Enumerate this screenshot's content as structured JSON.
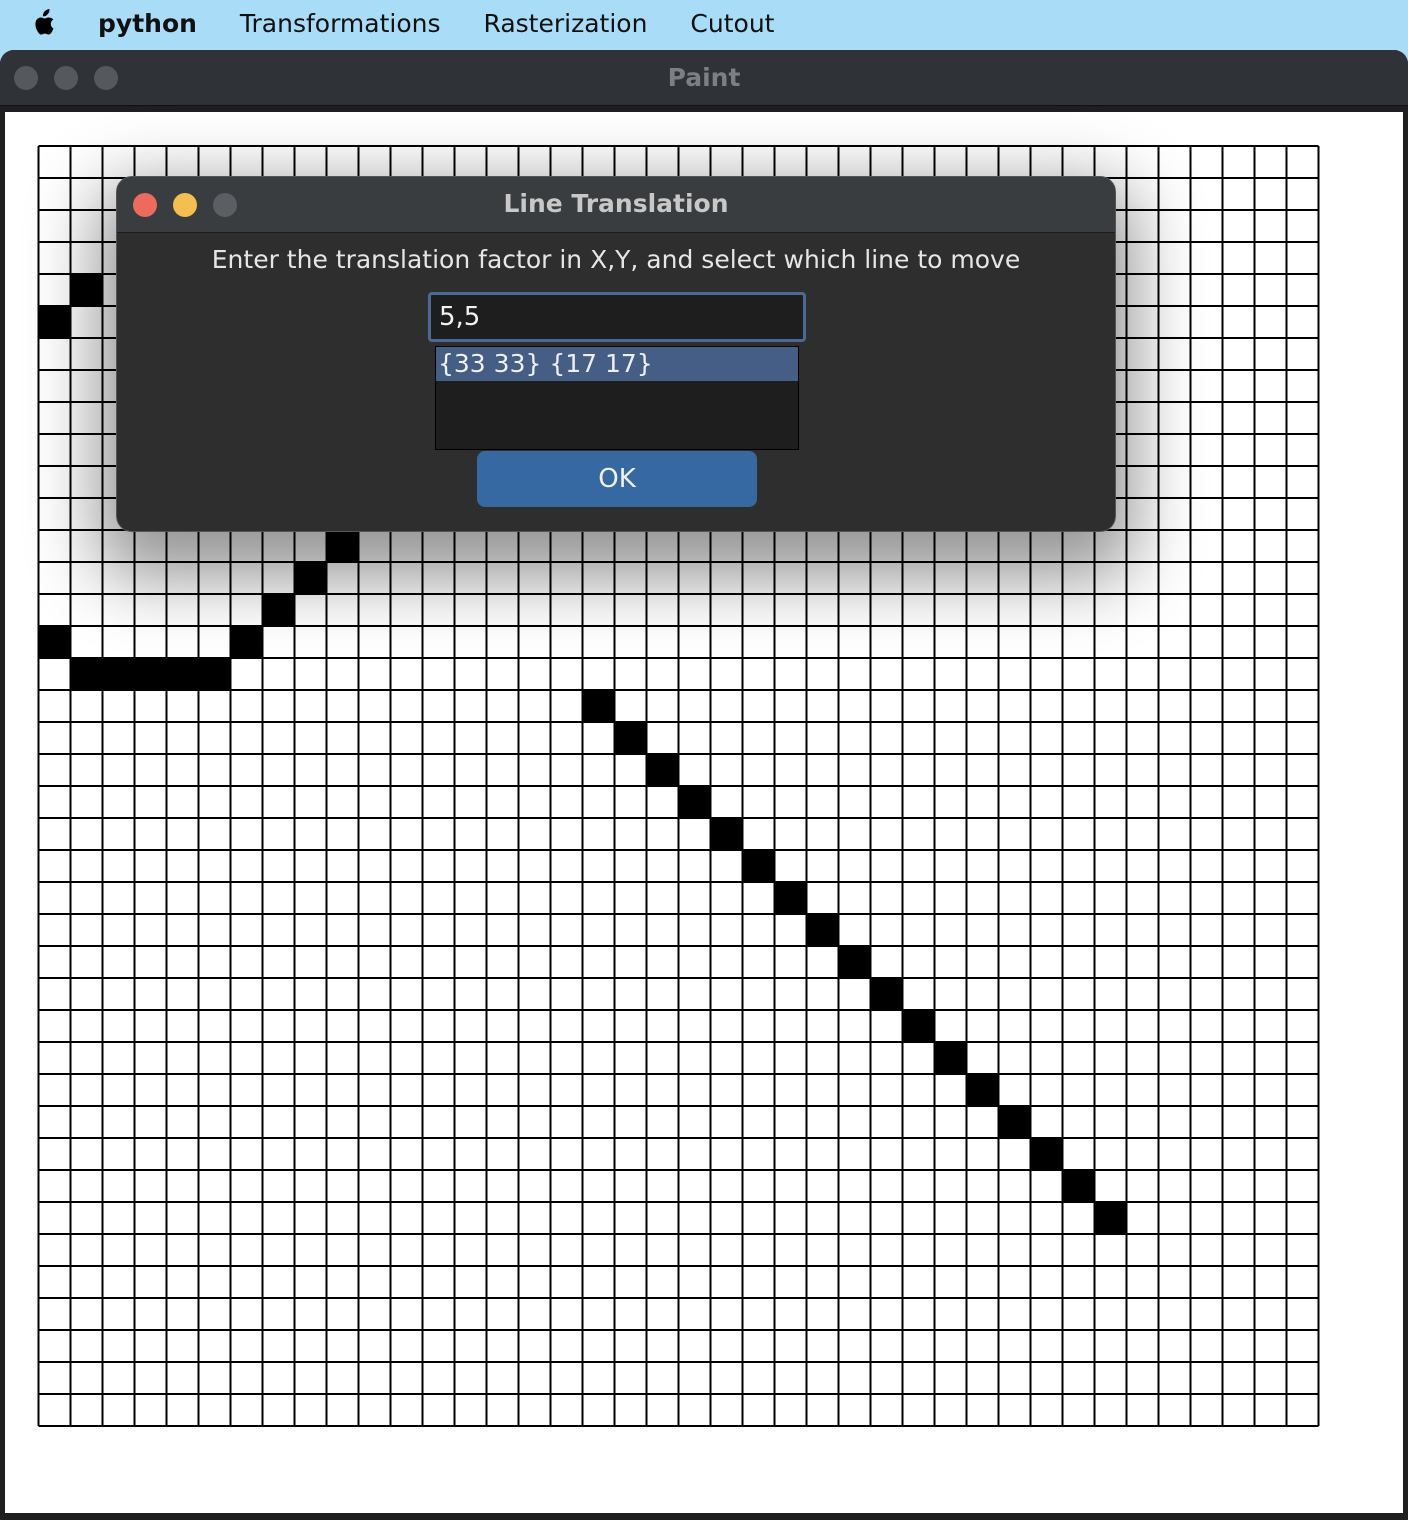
{
  "menubar": {
    "apple_icon": "apple-logo-icon",
    "items": [
      "python",
      "Transformations",
      "Rasterization",
      "Cutout"
    ]
  },
  "window": {
    "title": "Paint",
    "controls_color": "#55585c"
  },
  "canvas": {
    "grid_cells": [
      40,
      40
    ],
    "filled_cells": [
      [
        1,
        4
      ],
      [
        0,
        5
      ],
      [
        9,
        12
      ],
      [
        8,
        13
      ],
      [
        7,
        14
      ],
      [
        6,
        15
      ],
      [
        0,
        15
      ],
      [
        1,
        16
      ],
      [
        2,
        16
      ],
      [
        3,
        16
      ],
      [
        4,
        16
      ],
      [
        5,
        16
      ],
      [
        17,
        17
      ],
      [
        18,
        18
      ],
      [
        19,
        19
      ],
      [
        20,
        20
      ],
      [
        21,
        21
      ],
      [
        22,
        22
      ],
      [
        23,
        23
      ],
      [
        24,
        24
      ],
      [
        25,
        25
      ],
      [
        26,
        26
      ],
      [
        27,
        27
      ],
      [
        28,
        28
      ],
      [
        29,
        29
      ],
      [
        30,
        30
      ],
      [
        31,
        31
      ],
      [
        32,
        32
      ],
      [
        33,
        33
      ]
    ]
  },
  "dialog": {
    "title": "Line Translation",
    "prompt": "Enter the translation factor in X,Y, and select which line to move",
    "input_value": "5,5",
    "lines": [
      "{33 33} {17 17}"
    ],
    "selected_index": 0,
    "ok_label": "OK",
    "close_color": "#ec6a5e",
    "minimize_color": "#f4bf4f",
    "zoom_color": "#5b5e62"
  }
}
